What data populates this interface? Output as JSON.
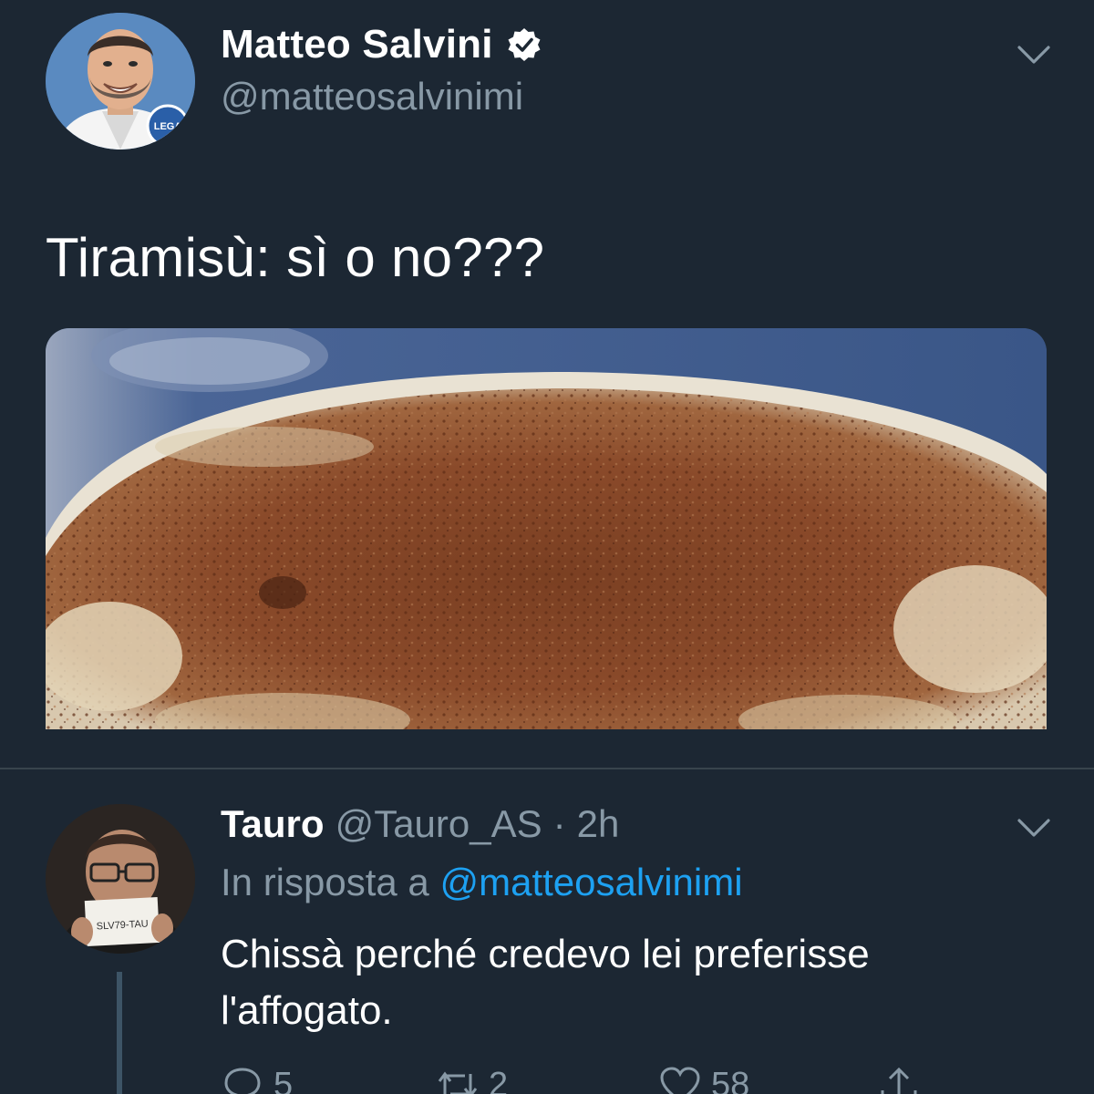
{
  "tweet": {
    "author_name": "Matteo Salvini",
    "author_handle": "@matteosalvinimi",
    "verified_icon": "verified-badge-icon",
    "text": "Tiramisù: sì o no???",
    "media_alt": "tiramisu-photo",
    "avatar_badge_text": "LEGA"
  },
  "reply": {
    "author_name": "Tauro",
    "author_handle": "@Tauro_AS",
    "separator": "·",
    "time": "2h",
    "context_prefix": "In risposta a",
    "context_mention": "@matteosalvinimi",
    "text": "Chissà perché credevo lei preferisse l'affogato.",
    "sign_text": "SLV79-TAU",
    "actions": {
      "replies": "5",
      "retweets": "2",
      "likes": "58"
    }
  },
  "colors": {
    "background": "#1c2733",
    "secondary_text": "#8899a6",
    "link": "#1da1f2",
    "divider": "#38444d"
  }
}
